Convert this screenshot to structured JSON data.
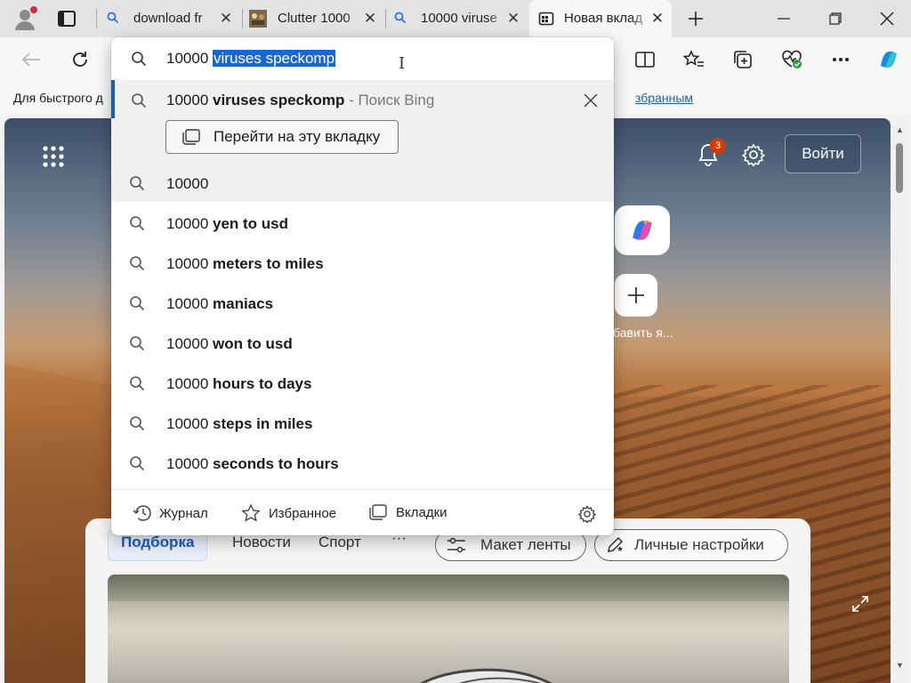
{
  "tabs": [
    {
      "title": "download fr",
      "icon": "search-icon"
    },
    {
      "title": "Clutter 1000",
      "icon": "game-favicon-icon"
    },
    {
      "title": "10000 viruse",
      "icon": "search-icon"
    },
    {
      "title": "Новая вклад",
      "icon": "newtab-icon",
      "active": true
    }
  ],
  "favorites_bar": {
    "left_text": "Для быстрого д",
    "right_text": "збранным"
  },
  "omnibox": {
    "typed": "10000 ",
    "selected": "viruses speckomp"
  },
  "top_suggestion": {
    "prefix": "10000 ",
    "bold": "viruses speckomp",
    "source": " - Поиск Bing",
    "switch_tab_label": "Перейти на эту вкладку"
  },
  "suggestions": [
    {
      "prefix": "10000",
      "bold": ""
    },
    {
      "prefix": "10000 ",
      "bold": "yen to usd"
    },
    {
      "prefix": "10000 ",
      "bold": "meters to miles"
    },
    {
      "prefix": "10000 ",
      "bold": "maniacs"
    },
    {
      "prefix": "10000 ",
      "bold": "won to usd"
    },
    {
      "prefix": "10000 ",
      "bold": "hours to days"
    },
    {
      "prefix": "10000 ",
      "bold": "steps in miles"
    },
    {
      "prefix": "10000 ",
      "bold": "seconds to hours"
    }
  ],
  "dropdown_footer": {
    "history": "Журнал",
    "favorites": "Избранное",
    "tabs": "Вкладки"
  },
  "ntp": {
    "notification_count": "3",
    "login_label": "Войти",
    "add_site_label": "бавить я...",
    "feed_tabs": [
      "Подборка",
      "Новости",
      "Спорт",
      "···"
    ],
    "layout_button": "Макет ленты",
    "personalize_button": "Личные настройки"
  },
  "colors": {
    "accent": "#1a5fb4",
    "selection": "#1a66d2",
    "badge": "#d83b01"
  }
}
